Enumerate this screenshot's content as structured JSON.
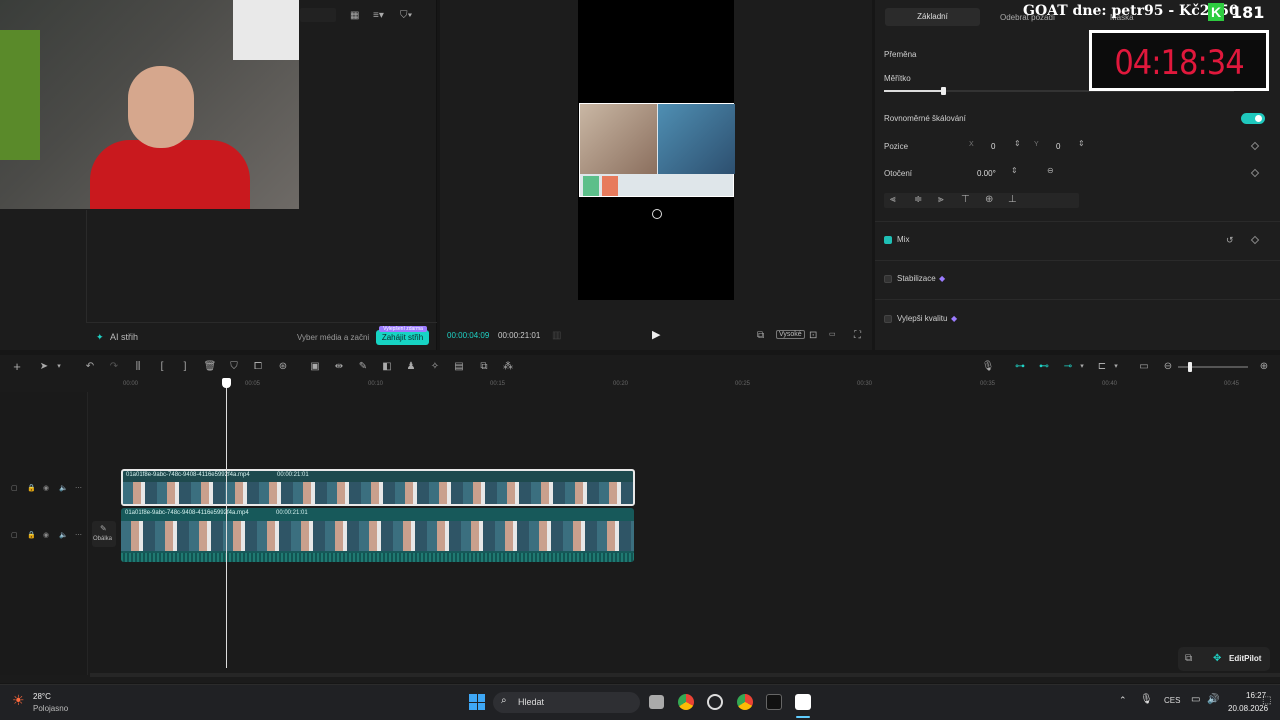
{
  "media": {
    "ai_cut_label": "AI střih",
    "choose_media_label": "Vyber média a začni",
    "start_cut_label": "Zahájit střih",
    "start_cut_badge": "Vylepšení zdarma"
  },
  "preview": {
    "current_time": "00:00:04:09",
    "total_time": "00:00:21:01",
    "quality_label": "Vysoké"
  },
  "props": {
    "tab_basic": "Základní",
    "tab_remove_bg": "Odebrat pozadí",
    "tab_mask": "Maska",
    "transform_label": "Přeměna",
    "scale_label": "Měřítko",
    "uniform_scale_label": "Rovnoměrné škálování",
    "position_label": "Pozice",
    "pos_x_label": "X",
    "pos_x_value": "0",
    "pos_y_label": "Y",
    "pos_y_value": "0",
    "rotation_label": "Otočení",
    "rotation_value": "0.00°",
    "mix_label": "Mix",
    "stabilize_label": "Stabilizace",
    "enhance_label": "Vylepši kvalitu"
  },
  "overlay": {
    "goat_text": "GOAT dne: petr95 - Kč2550",
    "goat_count": "181",
    "timer": "04:18:34"
  },
  "timeline": {
    "ruler": [
      "00:00",
      "00:05",
      "00:10",
      "00:15",
      "00:20",
      "00:25",
      "00:30",
      "00:35",
      "00:40",
      "00:45"
    ],
    "clip1_name": "01a01f8e-9abc-748c-9408-4116e5992f4a.mp4",
    "clip1_duration": "00:00:21:01",
    "clip2_name": "01a01f8e-9abc-748c-9408-4116e5992f4a.mp4",
    "clip2_duration": "00:00:21:01",
    "cover_label": "Obálka",
    "editpilot_label": "EditPilot"
  },
  "taskbar": {
    "weather_temp": "28°C",
    "weather_desc": "Polojasno",
    "search_label": "Hledat",
    "language": "CES",
    "time": "16:27",
    "date": "20.08.2026"
  },
  "colors": {
    "accent": "#1fd3c6",
    "timer_red": "#e0183c",
    "goat_green": "#2ecc40"
  }
}
